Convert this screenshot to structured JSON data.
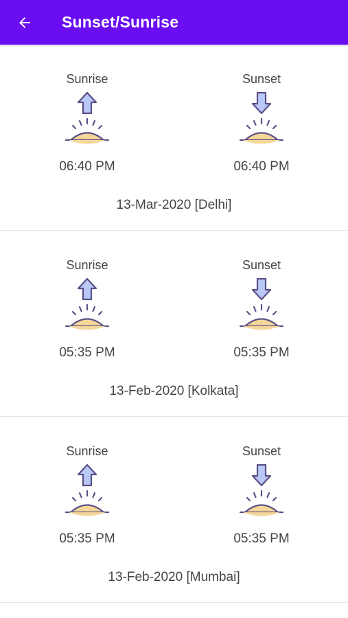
{
  "appbar": {
    "title": "Sunset/Sunrise",
    "back_icon": "arrow-left-icon",
    "color": "#6a0df0"
  },
  "cards": [
    {
      "sunrise_label": "Sunrise",
      "sunset_label": "Sunset",
      "sunrise_time": "06:40 PM",
      "sunset_time": "06:40 PM",
      "date_location": "13-Mar-2020 [Delhi]"
    },
    {
      "sunrise_label": "Sunrise",
      "sunset_label": "Sunset",
      "sunrise_time": "05:35 PM",
      "sunset_time": "05:35 PM",
      "date_location": "13-Feb-2020 [Kolkata]"
    },
    {
      "sunrise_label": "Sunrise",
      "sunset_label": "Sunset",
      "sunrise_time": "05:35 PM",
      "sunset_time": "05:35 PM",
      "date_location": "13-Feb-2020 [Mumbai]"
    }
  ],
  "icons": {
    "sunrise": "sunrise-icon",
    "sunset": "sunset-icon"
  },
  "colors": {
    "arrow_fill": "#b9c8f7",
    "sun_fill": "#f5d79a",
    "outline": "#5a4f86"
  }
}
